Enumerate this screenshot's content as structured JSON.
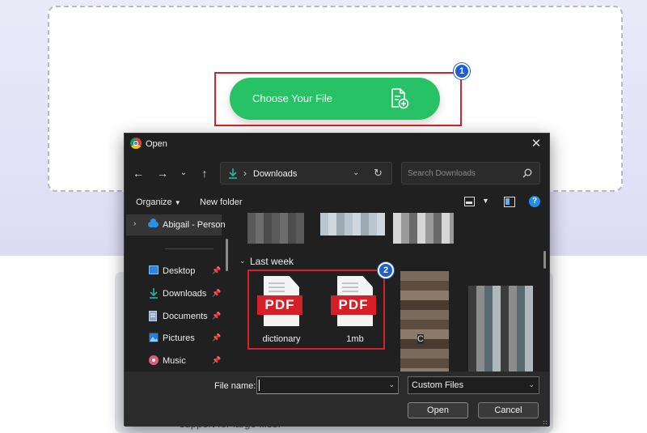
{
  "page": {
    "choose_button_label": "Choose Your File",
    "bottom_text": "support for large files."
  },
  "annotations": {
    "step1": "1",
    "step2": "2"
  },
  "dialog": {
    "title": "Open",
    "address": {
      "path": "Downloads"
    },
    "search": {
      "placeholder": "Search Downloads"
    },
    "toolbar": {
      "organize": "Organize",
      "new_folder": "New folder",
      "help": "?"
    },
    "sidebar": {
      "top_item": "Abigail - Person",
      "items": [
        {
          "label": "Desktop",
          "icon": "desktop-icon"
        },
        {
          "label": "Downloads",
          "icon": "download-icon"
        },
        {
          "label": "Documents",
          "icon": "document-icon"
        },
        {
          "label": "Pictures",
          "icon": "pictures-icon"
        },
        {
          "label": "Music",
          "icon": "music-icon"
        }
      ]
    },
    "files": {
      "section_label": "Last week",
      "items": [
        {
          "name": "dictionary",
          "badge": "PDF"
        },
        {
          "name": "1mb",
          "badge": "PDF"
        }
      ],
      "partial_label": "C"
    },
    "footer": {
      "file_name_label": "File name:",
      "file_name_value": "",
      "file_type": "Custom Files",
      "open_label": "Open",
      "cancel_label": "Cancel"
    }
  },
  "colors": {
    "accent_green": "#27c265",
    "highlight_red": "#d8202a",
    "badge_blue": "#1d5fd0",
    "dialog_bg": "#202020"
  }
}
